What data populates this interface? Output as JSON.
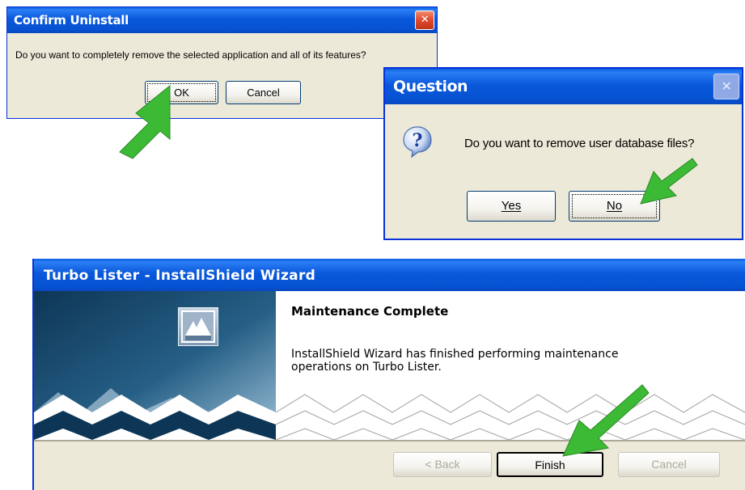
{
  "confirm_dialog": {
    "title": "Confirm Uninstall",
    "close_glyph": "✕",
    "message": "Do you want to completely remove the selected application and all of its features?",
    "ok_label": "OK",
    "cancel_label": "Cancel"
  },
  "question_dialog": {
    "title": "Question",
    "close_glyph": "✕",
    "icon": "question-icon",
    "icon_glyph": "?",
    "message": "Do you want to remove user database files?",
    "yes_label": "Yes",
    "no_label": "No"
  },
  "wizard": {
    "title": "Turbo Lister - InstallShield Wizard",
    "heading": "Maintenance Complete",
    "body_line1": "InstallShield Wizard has finished performing maintenance",
    "body_line2": "operations on Turbo Lister.",
    "back_label": "< Back",
    "finish_label": "Finish",
    "cancel_label": "Cancel"
  },
  "colors": {
    "title_bar": "#0a58db",
    "dialog_face": "#ece9d8",
    "close_red": "#e0492c",
    "arrow_green": "#3cb935"
  }
}
